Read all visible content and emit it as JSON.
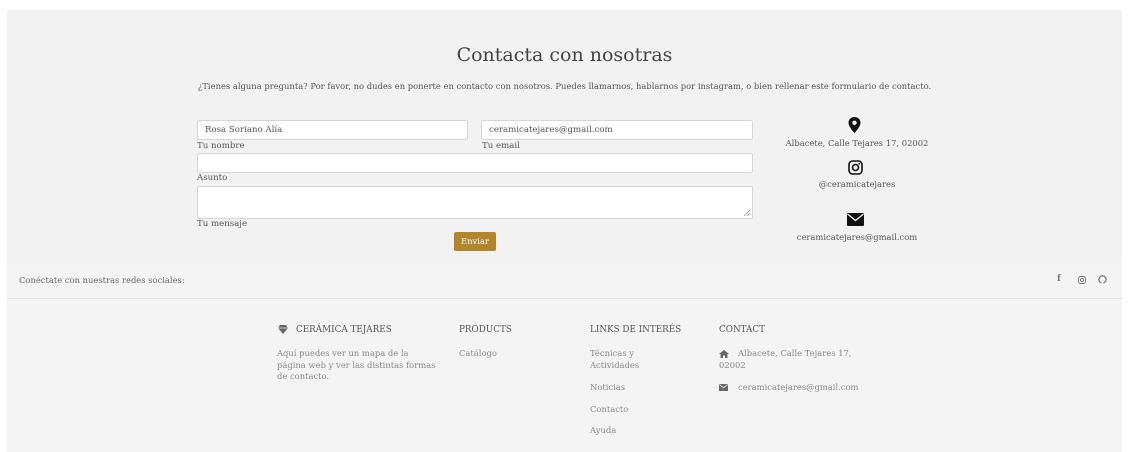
{
  "contact": {
    "title": "Contacta con nosotras",
    "intro": "¿Tienes alguna pregunta? Por favor, no dudes en ponerte en contacto con nosotros. Puedes llamarnos, hablarnos por instagram, o bien rellenar este formulario de contacto.",
    "name_value": "Rosa Soriano Alía",
    "name_label": "Tu nombre",
    "email_value": "ceramicatejares@gmail.com",
    "email_label": "Tu email",
    "subject_label": "Asunto",
    "message_label": "Tu mensaje",
    "send_label": "Enviar",
    "address": "Albacete, Calle Tejares 17, 02002",
    "instagram": "@ceramicatejares",
    "email": "ceramicatejares@gmail.com"
  },
  "social": {
    "text": "Conéctate con nuestras redes sociales:",
    "icons": [
      "facebook-icon",
      "instagram-icon",
      "github-icon"
    ]
  },
  "footer": {
    "brand": {
      "title": "CERÁMICA TEJARES",
      "text": "Aquí puedes ver un mapa de la página web y ver las distintas formas de contacto."
    },
    "products": {
      "title": "PRODUCTS",
      "items": [
        "Catálogo"
      ]
    },
    "links": {
      "title": "LINKS DE INTERÉS",
      "items": [
        "Técnicas y Actividades",
        "Noticias",
        "Contacto",
        "Ayuda"
      ]
    },
    "contact": {
      "title": "CONTACT",
      "address": "Albacete, Calle Tejares 17, 02002",
      "email": "ceramicatejares@gmail.com"
    }
  },
  "colors": {
    "accent": "#b3862d",
    "background": "#f2f2f2"
  }
}
